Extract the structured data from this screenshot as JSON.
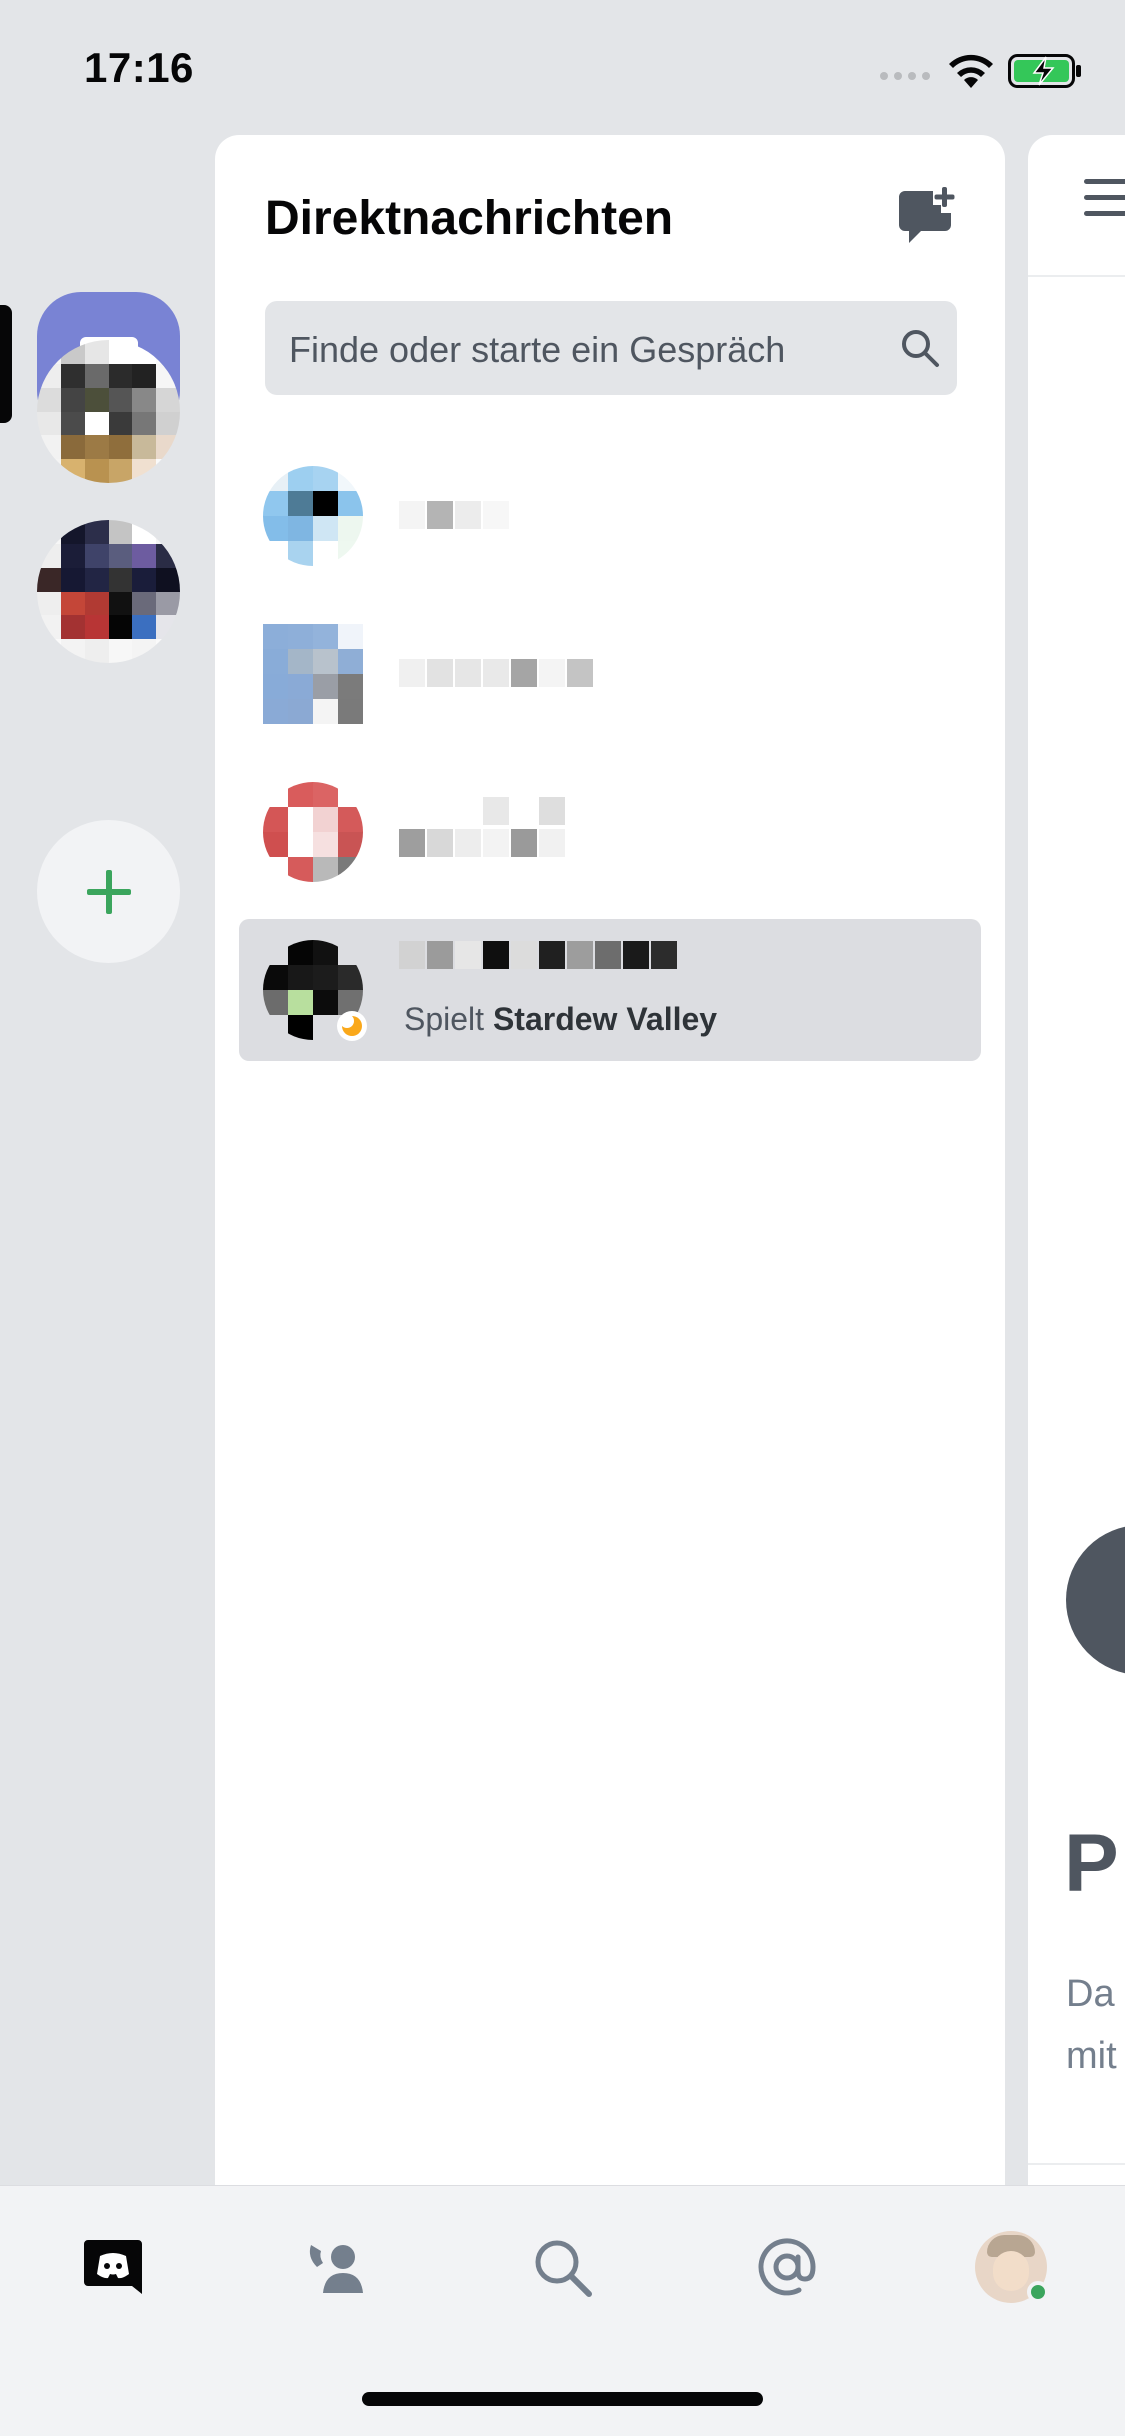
{
  "status_bar": {
    "time": "17:16",
    "wifi_icon": "wifi-icon",
    "battery_icon": "battery-charging-icon",
    "battery_color": "#34c759"
  },
  "servers": {
    "home_icon": "chat-bubble-icon",
    "home_color": "#7983d4",
    "add_icon": "plus-icon",
    "add_color": "#3ba55d"
  },
  "dm_panel": {
    "title": "Direktnachrichten",
    "new_dm_icon": "new-message-icon",
    "search": {
      "placeholder": "Finde oder starte ein Gespräch",
      "icon": "search-icon"
    },
    "items": [
      {
        "activity_prefix": "",
        "activity_game": "",
        "selected": false
      },
      {
        "activity_prefix": "",
        "activity_game": "",
        "selected": false
      },
      {
        "activity_prefix": "",
        "activity_game": "",
        "selected": false
      },
      {
        "activity_prefix": "Spielt",
        "activity_game": "Stardew Valley",
        "selected": true,
        "status": "idle"
      }
    ]
  },
  "right_panel": {
    "menu_icon": "hamburger-menu-icon",
    "heading_fragment": "P",
    "text_line_1": "Da",
    "text_line_2": "mit"
  },
  "tab_bar": {
    "tabs": [
      {
        "icon": "discord-home-icon",
        "active": true
      },
      {
        "icon": "friends-icon",
        "active": false
      },
      {
        "icon": "search-icon",
        "active": false
      },
      {
        "icon": "mentions-icon",
        "active": false
      },
      {
        "icon": "profile-avatar-icon",
        "active": false
      }
    ]
  },
  "colors": {
    "blurple": "#5865f2",
    "online_green": "#3ba55d",
    "idle_yellow": "#faa81a"
  }
}
